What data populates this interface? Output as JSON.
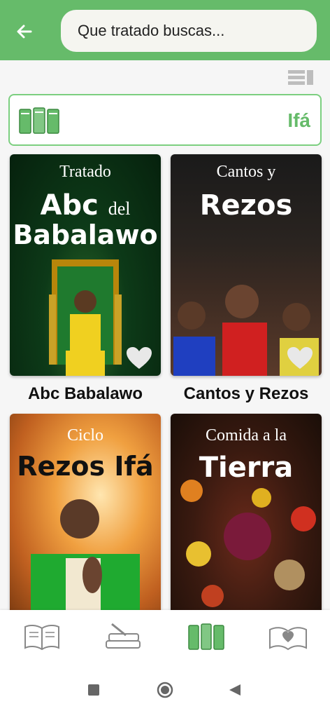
{
  "header": {
    "back_icon": "arrow-left-icon",
    "search_placeholder": "Que tratado buscas..."
  },
  "colors": {
    "accent": "#66bb6a",
    "accent_border": "#7ccf80",
    "text": "#111111"
  },
  "view_toggle_icon": "grid-list-toggle-icon",
  "filter": {
    "icon": "books-icon",
    "label": "Ifá"
  },
  "cards": [
    {
      "pre": "Tratado",
      "big1": "Abc",
      "big1_small": "del",
      "big2": "Babalawo",
      "title": "Abc Babalawo"
    },
    {
      "pre": "Cantos y",
      "big1": "Rezos",
      "title": "Cantos y Rezos"
    },
    {
      "pre": "Ciclo",
      "big1": "Rezos Ifá",
      "title": ""
    },
    {
      "pre": "Comida a la",
      "big1": "Tierra",
      "title": ""
    }
  ],
  "bottom_nav": [
    "open-book-icon",
    "books-stack-icon",
    "library-icon",
    "heart-book-icon"
  ],
  "system_nav": [
    "recents-square-icon",
    "home-circle-icon",
    "back-triangle-icon"
  ]
}
